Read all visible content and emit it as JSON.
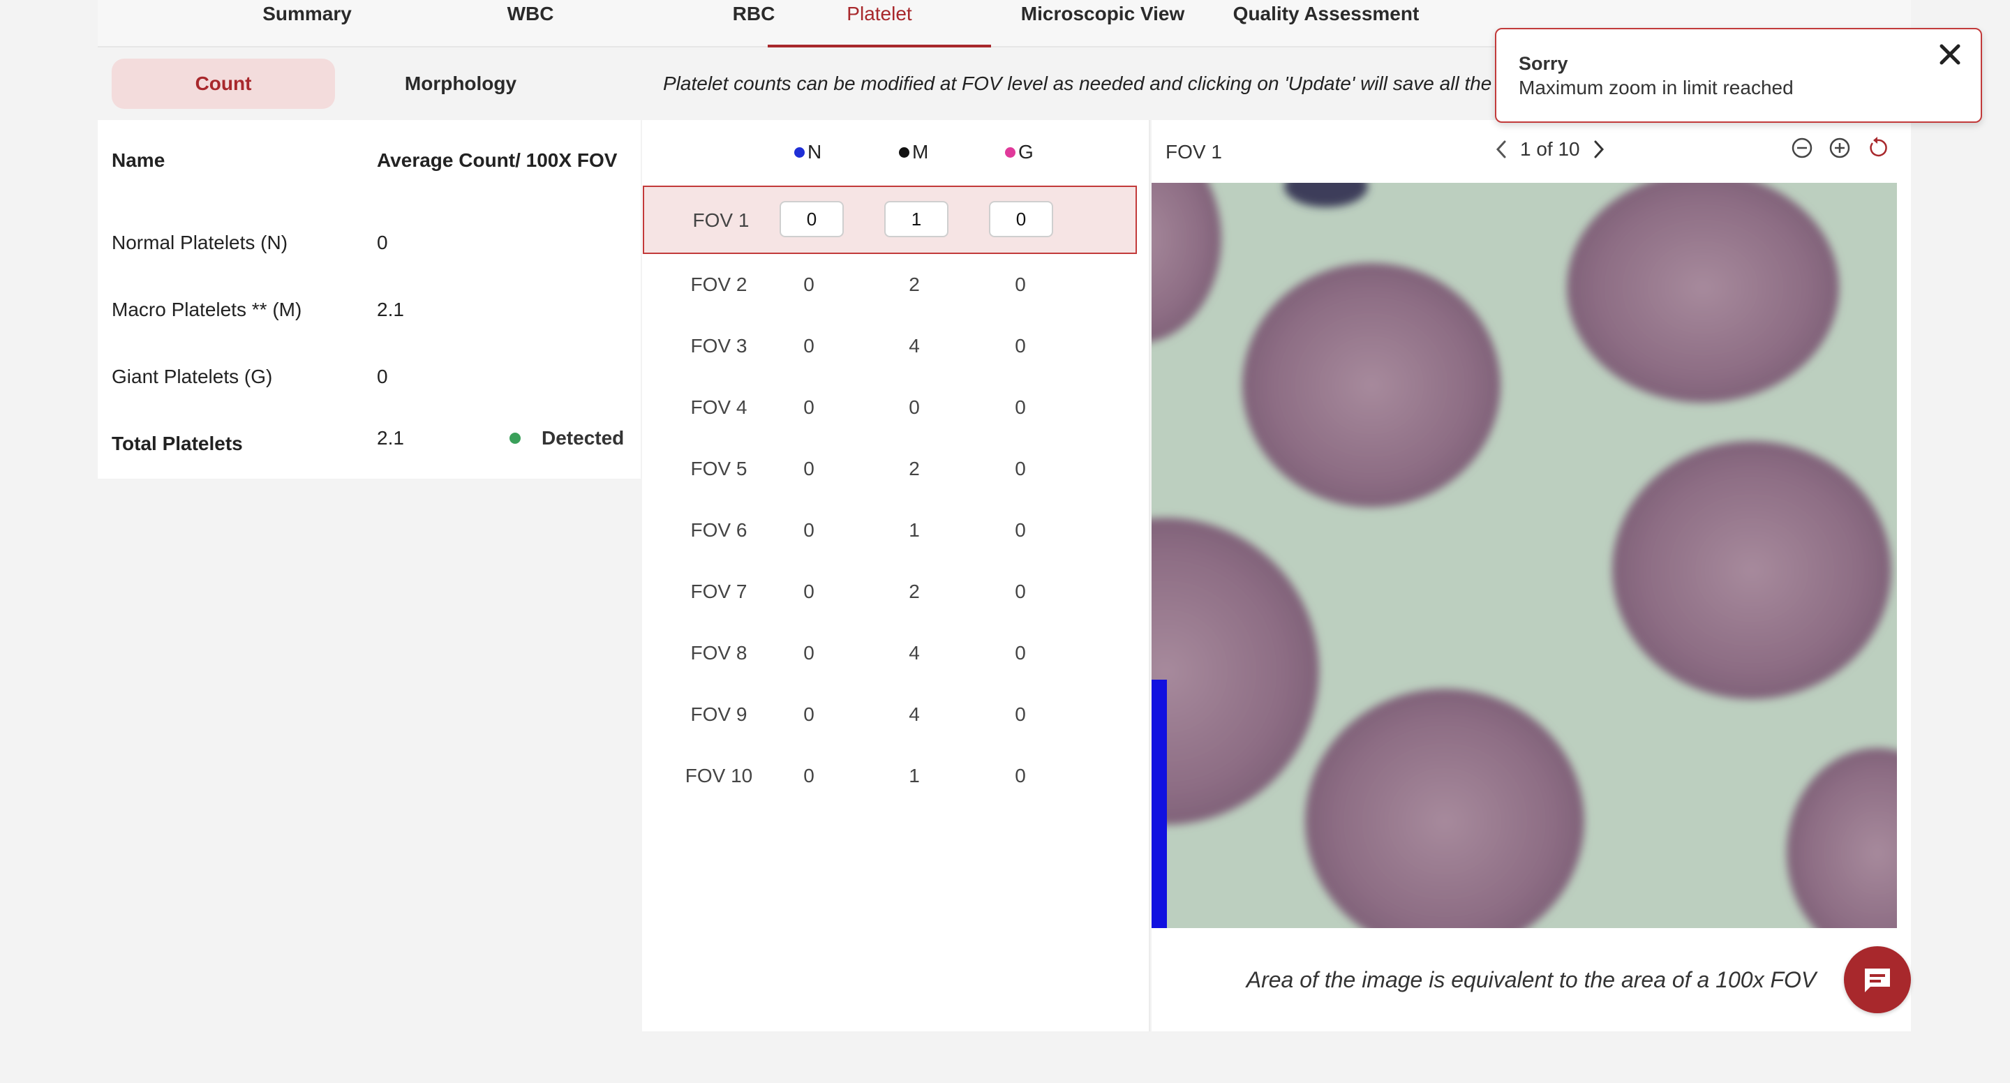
{
  "tabs": [
    {
      "label": "Summary",
      "active": false
    },
    {
      "label": "WBC",
      "active": false
    },
    {
      "label": "RBC",
      "active": false
    },
    {
      "label": "Platelet",
      "active": true
    },
    {
      "label": "Microscopic View",
      "active": false
    },
    {
      "label": "Quality Assessment",
      "active": false
    }
  ],
  "subtabs": [
    {
      "label": "Count",
      "active": true
    },
    {
      "label": "Morphology",
      "active": false
    }
  ],
  "banner": "Platelet counts can be modified at FOV level as needed and clicking on 'Update' will save all the",
  "summary": {
    "header": {
      "name": "Name",
      "value": "Average Count/ 100X FOV"
    },
    "rows": [
      {
        "name": "Normal Platelets (N)",
        "value": "0"
      },
      {
        "name": "Macro Platelets ** (M)",
        "value": "2.1"
      },
      {
        "name": "Giant Platelets (G)",
        "value": "0"
      }
    ],
    "total": {
      "name": "Total Platelets",
      "value": "2.1",
      "status": "Detected",
      "status_color": "#3aa05a"
    }
  },
  "legend": [
    {
      "label": "N",
      "color": "#1f2fd6"
    },
    {
      "label": "M",
      "color": "#111111"
    },
    {
      "label": "G",
      "color": "#e0399a"
    }
  ],
  "fovs": [
    {
      "label": "FOV 1",
      "n": "0",
      "m": "1",
      "g": "0",
      "selected": true
    },
    {
      "label": "FOV 2",
      "n": "0",
      "m": "2",
      "g": "0"
    },
    {
      "label": "FOV 3",
      "n": "0",
      "m": "4",
      "g": "0"
    },
    {
      "label": "FOV 4",
      "n": "0",
      "m": "0",
      "g": "0"
    },
    {
      "label": "FOV 5",
      "n": "0",
      "m": "2",
      "g": "0"
    },
    {
      "label": "FOV 6",
      "n": "0",
      "m": "1",
      "g": "0"
    },
    {
      "label": "FOV 7",
      "n": "0",
      "m": "2",
      "g": "0"
    },
    {
      "label": "FOV 8",
      "n": "0",
      "m": "4",
      "g": "0"
    },
    {
      "label": "FOV 9",
      "n": "0",
      "m": "4",
      "g": "0"
    },
    {
      "label": "FOV 10",
      "n": "0",
      "m": "1",
      "g": "0"
    }
  ],
  "viewer": {
    "title": "FOV 1",
    "pager": "1 of 10",
    "caption": "Area of the image is equivalent to the area of a 100x FOV"
  },
  "toast": {
    "title": "Sorry",
    "message": "Maximum zoom in limit reached"
  },
  "colors": {
    "accent": "#a8282c",
    "selected_row_bg": "#f6e4e4"
  }
}
